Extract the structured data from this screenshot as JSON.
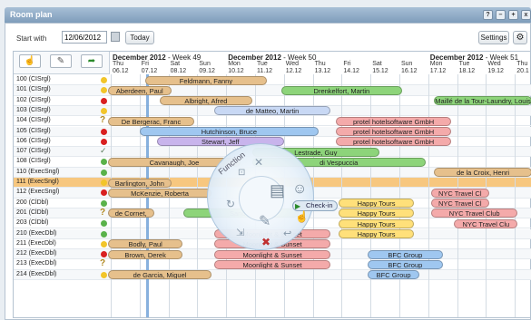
{
  "window": {
    "title": "Room plan",
    "buttons": [
      "?",
      "–",
      "+",
      "x"
    ]
  },
  "toolbar": {
    "start_label": "Start with",
    "start_value": "12/06/2012",
    "today_label": "Today",
    "settings_label": "Settings",
    "gear_icon": "gear-icon"
  },
  "weeks": [
    {
      "month": "December 2012",
      "week": " - Week 49"
    },
    {
      "month": "December 2012",
      "week": " - Week 50"
    },
    {
      "month": "December 2012",
      "week": " - Week 51"
    }
  ],
  "days": [
    {
      "name": "Thu",
      "date": "06.12"
    },
    {
      "name": "Fri",
      "date": "07.12"
    },
    {
      "name": "Sat",
      "date": "08.12"
    },
    {
      "name": "Sun",
      "date": "09.12"
    },
    {
      "name": "Mon",
      "date": "10.12"
    },
    {
      "name": "Tue",
      "date": "11.12"
    },
    {
      "name": "Wed",
      "date": "12.12"
    },
    {
      "name": "Thu",
      "date": "13.12"
    },
    {
      "name": "Fri",
      "date": "14.12"
    },
    {
      "name": "Sat",
      "date": "15.12"
    },
    {
      "name": "Sun",
      "date": "16.12"
    },
    {
      "name": "Mon",
      "date": "17.12"
    },
    {
      "name": "Tue",
      "date": "18.12"
    },
    {
      "name": "Wed",
      "date": "19.12"
    },
    {
      "name": "Thu",
      "date": "20.1"
    }
  ],
  "rooms": [
    "100 (CISrgl)",
    "101 (CISrgl)",
    "102 (CISrgl)",
    "103 (CISrgl)",
    "104 (CISrgl)",
    "105 (CISrgl)",
    "106 (CISrgl)",
    "107 (CISrgl)",
    "108 (CISrgl)",
    "110 (ExecSngl)",
    "111 (ExecSngl)",
    "112 (ExecSngl)",
    "200 (ClDbl)",
    "201 (ClDbl)",
    "203 (ClDbl)",
    "210 (ExecDbl)",
    "211 (ExecDbl)",
    "212 (ExecDbl)",
    "213 (ExecDbl)",
    "214 (ExecDbl)"
  ],
  "status_colors": {
    "clean": "#f2c52a",
    "dirty": "#d92020",
    "inspected": "#5ab24a"
  },
  "bookings": [
    {
      "text": "Feldmann, Fanny"
    },
    {
      "text": "Aberdeen, Paul"
    },
    {
      "text": "Drenkelfort, Martin"
    },
    {
      "text": "Albright, Afred"
    },
    {
      "text": "Maillé de la Tour-Laundry, Louis"
    },
    {
      "text": "de Matteo, Martin"
    },
    {
      "text": "De Bergerac, Franc"
    },
    {
      "text": "protel hotelsoftware GmbH"
    },
    {
      "text": "Hutchinson, Bruce"
    },
    {
      "text": "protel hotelsoftware GmbH"
    },
    {
      "text": "Stewart, Jeff"
    },
    {
      "text": "protel hotelsoftware GmbH"
    },
    {
      "text": "Lestrade, Guy"
    },
    {
      "text": "Cavanaugh, Joe"
    },
    {
      "text": "di Vespuccia"
    },
    {
      "text": "de la Croix, Henri"
    },
    {
      "text": "Barlington, John"
    },
    {
      "text": "McKenzie, Roberta"
    },
    {
      "text": "NYC Travel Cl"
    },
    {
      "text": "Happy Tours"
    },
    {
      "text": "NYC Travel Cl"
    },
    {
      "text": "de Cornet,"
    },
    {
      "text": "Sander"
    },
    {
      "text": "Happy Tours"
    },
    {
      "text": "NYC Travel Club"
    },
    {
      "text": "Happy Tours"
    },
    {
      "text": "NYC Travel Clu"
    },
    {
      "text": "Moonlight & Sunset"
    },
    {
      "text": "Happy Tours"
    },
    {
      "text": "Bodly, Paul"
    },
    {
      "text": "Moonlight & Sunset"
    },
    {
      "text": "Brown, Derek"
    },
    {
      "text": "Moonlight & Sunset"
    },
    {
      "text": "BFC Group"
    },
    {
      "text": "Moonlight & Sunset"
    },
    {
      "text": "BFC Group"
    },
    {
      "text": "de Garcia, Miguel"
    },
    {
      "text": "BFC Group"
    }
  ],
  "function_menu": {
    "label": "Function",
    "checkin": "Check-in"
  }
}
